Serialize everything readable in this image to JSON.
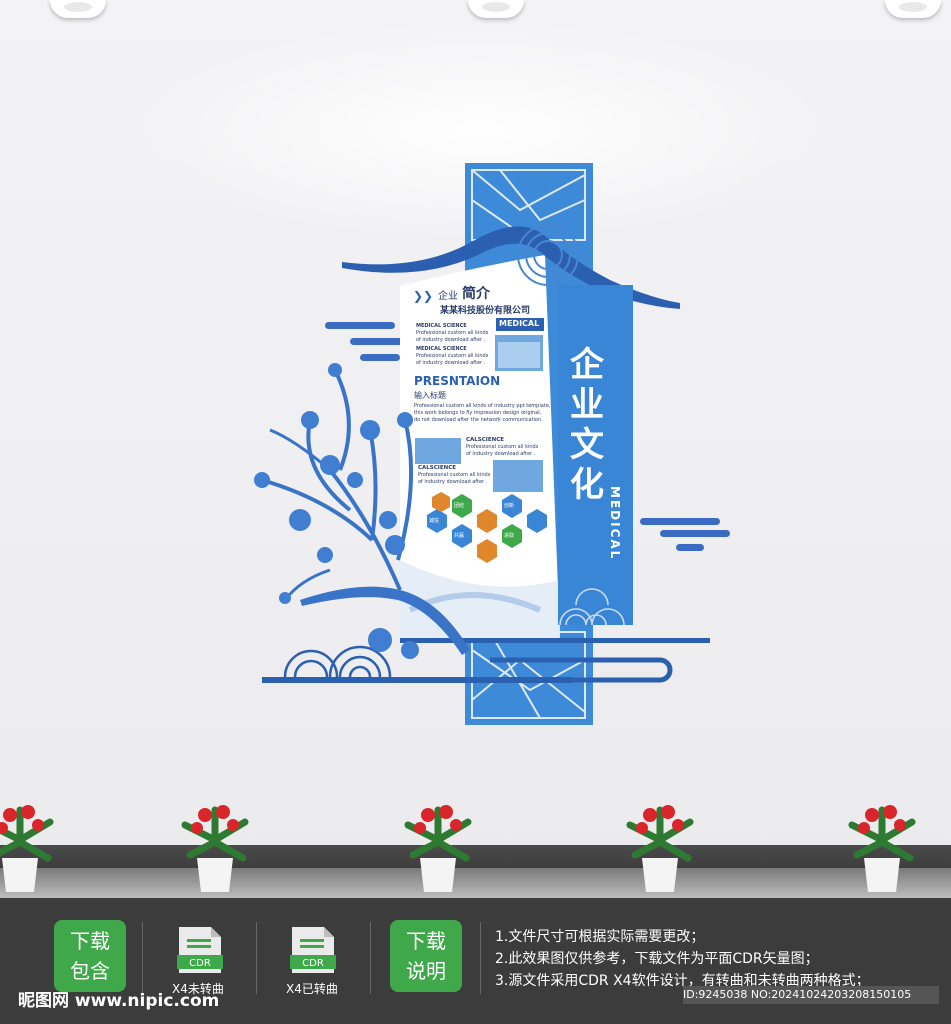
{
  "colors": {
    "brand_blue": "#3a7fcf",
    "dark_blue": "#2b5fb0",
    "green": "#3fa84a",
    "orange": "#e0862b"
  },
  "panel": {
    "vertical_title": "企业文化",
    "vertical_sub": "MEDICAL",
    "intro_prefix": "企业",
    "intro_title": "简介",
    "company": "某某科技股份有限公司",
    "medical_tag": "MEDICAL",
    "sci1_head": "MEDICAL SCIENCE",
    "sci1_l1": "Professional custom all kinds",
    "sci1_l2": "of industry download after .",
    "sci2_head": "MEDICAL SCIENCE",
    "sci2_l1": "Professional custom all kinds",
    "sci2_l2": "of industry download after .",
    "presentation": "PRESNTAION",
    "input_title": "输入标题",
    "para1": "Professional custom all kinds of industry ppt template,",
    "para2": "this work belongs to fly impression design original,",
    "para3": "do not download after the network communication.",
    "cal1_head": "CALSCIENCE",
    "cal1_l1": "Professional custom all kinds",
    "cal1_l2": "of industry download after .",
    "cal2_head": "CALSCIENCE",
    "cal2_l1": "Professional custom all kinds",
    "cal2_l2": "of industry download after .",
    "hex_labels": [
      "诚信",
      "团结",
      "创新",
      "进取",
      "共赢"
    ]
  },
  "footer": {
    "download_includes": [
      "下载",
      "包含"
    ],
    "file1_label": "X4未转曲",
    "file2_label": "X4已转曲",
    "file_icon_text": "CDR",
    "download_notes_btn": [
      "下载",
      "说明"
    ],
    "notes": [
      "1.文件尺寸可根据实际需要更改；",
      "2.此效果图仅供参考，下载文件为平面CDR矢量图；",
      "3.源文件采用CDR X4软件设计，有转曲和未转曲两种格式；"
    ],
    "watermark": "昵图网 www.nipic.com",
    "id_text": "ID:9245038 NO:20241024203208150105"
  }
}
